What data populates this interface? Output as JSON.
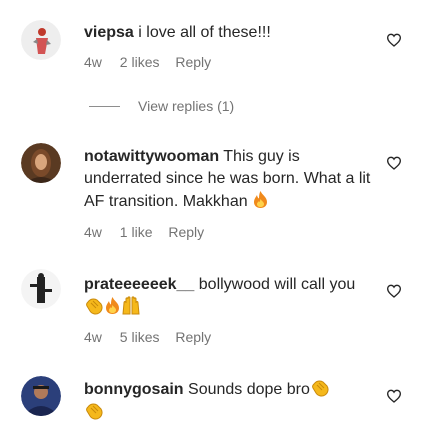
{
  "colors": {
    "text": "#262626",
    "meta": "#737373",
    "emoji_fire": "#f08a1c",
    "emoji_clap": "#f5b81b"
  },
  "comments": [
    {
      "username": "viepsa",
      "text": "i love all of these!!!",
      "time": "4w",
      "likes": "2 likes",
      "reply": "Reply",
      "view_replies": "View replies (1)"
    },
    {
      "username": "notawittywooman",
      "text": "This guy is underrated since he was born. What a lit AF transition. Makkhan",
      "time": "4w",
      "likes": "1 like",
      "reply": "Reply"
    },
    {
      "username": "prateeeeeek__",
      "text": "bollywood will call you",
      "time": "4w",
      "likes": "5 likes",
      "reply": "Reply"
    },
    {
      "username": "bonnygosain",
      "text": "Sounds dope bro"
    }
  ],
  "icons": {
    "like": "heart-outline-icon",
    "fire": "fire-emoji",
    "clap": "clapping-hands-emoji",
    "raised_hands": "raised-hands-emoji"
  }
}
